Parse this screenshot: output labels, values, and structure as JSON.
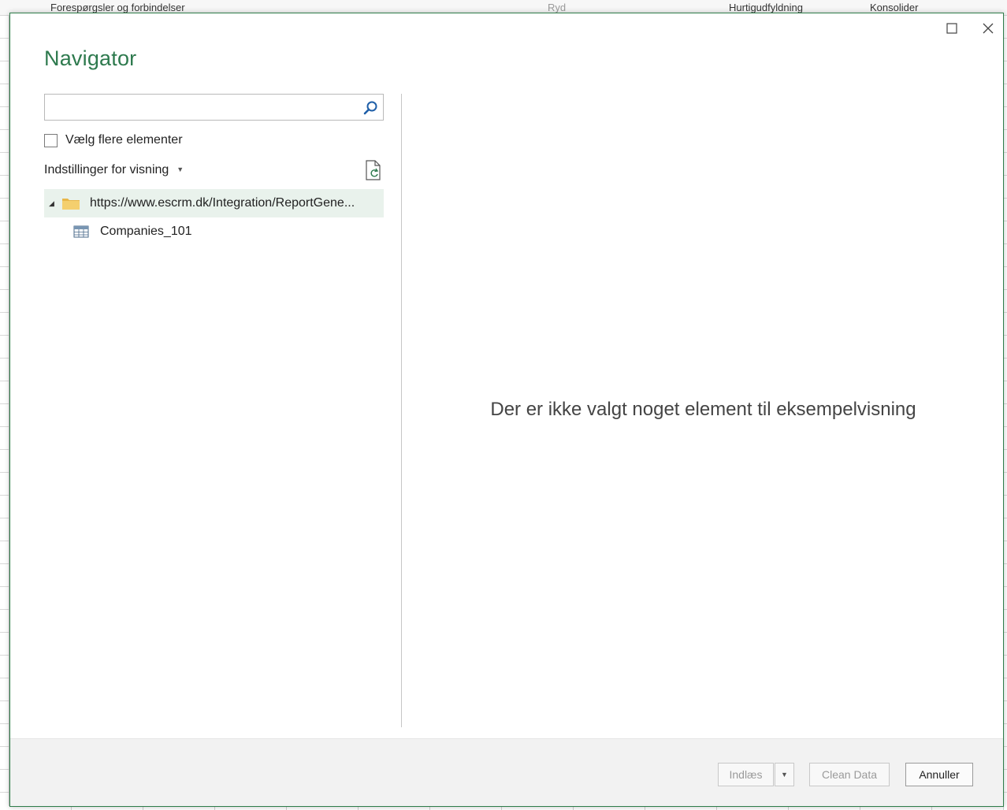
{
  "background": {
    "ribbon_items": [
      {
        "label": "Forespørgsler og forbindelser"
      },
      {
        "label": "Ryd"
      },
      {
        "label": "Hurtigudfyldning"
      },
      {
        "label": "Konsolider"
      }
    ]
  },
  "dialog": {
    "title": "Navigator",
    "accent_color": "#2e7a4e"
  },
  "left_pane": {
    "search": {
      "value": "",
      "placeholder": ""
    },
    "select_multiple_label": "Vælg flere elementer",
    "view_settings_label": "Indstillinger for visning",
    "tree": {
      "root": {
        "label": "https://www.escrm.dk/Integration/ReportGene...",
        "icon": "folder-icon",
        "expanded": true
      },
      "children": [
        {
          "label": "Companies_101",
          "icon": "table-icon"
        }
      ]
    }
  },
  "preview": {
    "empty_message": "Der er ikke valgt noget element til eksempelvisning"
  },
  "footer": {
    "load_label": "Indlæs",
    "clean_label": "Clean Data",
    "cancel_label": "Annuller"
  }
}
